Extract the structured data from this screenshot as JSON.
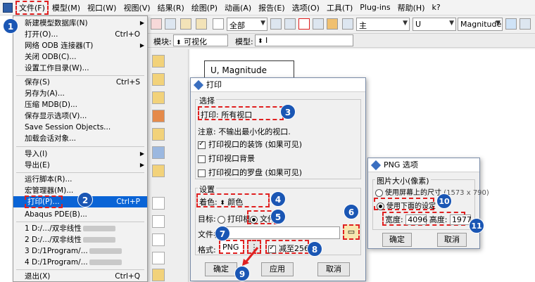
{
  "menubar": {
    "items": [
      "文件(F)",
      "模型(M)",
      "视口(W)",
      "视图(V)",
      "结果(R)",
      "绘图(P)",
      "动画(A)",
      "报告(E)",
      "选项(O)",
      "工具(T)",
      "Plug-ins",
      "帮助(H)",
      "k?"
    ]
  },
  "toolbar": {
    "combo_all": "全部",
    "combo_main": "主",
    "combo_u": "U",
    "combo_magnitude": "Magnitude"
  },
  "modrow": {
    "module_label": "模块:",
    "module_value": "可视化",
    "model_label": "模型:",
    "model_value": "I"
  },
  "viewport": {
    "legend_title": "U, Magnitude"
  },
  "file_menu": {
    "items": [
      {
        "label": "新建模型数据库(N)",
        "shortcut": "",
        "submenu": true
      },
      {
        "label": "打开(O)...",
        "shortcut": "Ctrl+O",
        "submenu": false
      },
      {
        "label": "网络 ODB 连接器(T)",
        "shortcut": "",
        "submenu": true
      },
      {
        "label": "关闭 ODB(C)...",
        "shortcut": "",
        "submenu": false
      },
      {
        "label": "设置工作目录(W)...",
        "shortcut": "",
        "submenu": false
      },
      {
        "label": "保存(S)",
        "shortcut": "Ctrl+S",
        "submenu": false
      },
      {
        "label": "另存为(A)...",
        "shortcut": "",
        "submenu": false
      },
      {
        "label": "压缩 MDB(D)...",
        "shortcut": "",
        "submenu": false
      },
      {
        "label": "保存显示选项(V)...",
        "shortcut": "",
        "submenu": false
      },
      {
        "label": "Save Session Objects...",
        "shortcut": "",
        "submenu": false
      },
      {
        "label": "加载会话对象...",
        "shortcut": "",
        "submenu": false
      },
      {
        "label": "导入(I)",
        "shortcut": "",
        "submenu": true
      },
      {
        "label": "导出(E)",
        "shortcut": "",
        "submenu": true
      },
      {
        "label": "运行脚本(R)...",
        "shortcut": "",
        "submenu": false
      },
      {
        "label": "宏管理器(M)...",
        "shortcut": "",
        "submenu": false
      },
      {
        "label": "打印(P)...",
        "shortcut": "Ctrl+P",
        "submenu": false
      },
      {
        "label": "Abaqus PDE(B)...",
        "shortcut": "",
        "submenu": false
      },
      {
        "label": "1 D:/.../双非线性",
        "shortcut": "",
        "submenu": false
      },
      {
        "label": "2 D:/.../双非线性",
        "shortcut": "",
        "submenu": false
      },
      {
        "label": "3 D:/1Program/...",
        "shortcut": "",
        "submenu": false
      },
      {
        "label": "4 D:/1Program/...",
        "shortcut": "",
        "submenu": false
      },
      {
        "label": "退出(X)",
        "shortcut": "Ctrl+Q",
        "submenu": false
      }
    ]
  },
  "print_dialog": {
    "title": "打印",
    "select_group": "选择",
    "print_label": "打印:",
    "print_value": "所有视口",
    "note": "注意: 不输出最小化的视口.",
    "cb_decor": "打印视口的装饰 (如果可见)",
    "cb_bg": "打印视口背景",
    "cb_compass": "打印视口的罗盘 (如果可见)",
    "settings_group": "设置",
    "render_label": "着色:",
    "render_value": "颜色",
    "target_label": "目标:",
    "target_printer": "打印机",
    "target_file": "文件",
    "filename_label": "文件名:",
    "format_label": "格式:",
    "format_value": "PNG",
    "reduce_label": "减至256色",
    "btn_ok": "确定",
    "btn_apply": "应用",
    "btn_cancel": "取消"
  },
  "png_dialog": {
    "title": "PNG 选项",
    "group": "图片大小(像素)",
    "opt_screen": "使用屏幕上的尺寸",
    "opt_screen_size": "(1573 x 790)",
    "opt_custom": "使用下面的设定",
    "width_label": "宽度:",
    "width_value": "4096",
    "height_label": "高度:",
    "height_value": "1977",
    "btn_ok": "确定",
    "btn_cancel": "取消"
  },
  "badges": [
    "1",
    "2",
    "3",
    "4",
    "5",
    "6",
    "7",
    "8",
    "9",
    "10",
    "11"
  ],
  "colors": {
    "highlight": "#0a64d6",
    "dash_red": "#e02020",
    "badge_blue": "#1a56b4"
  }
}
